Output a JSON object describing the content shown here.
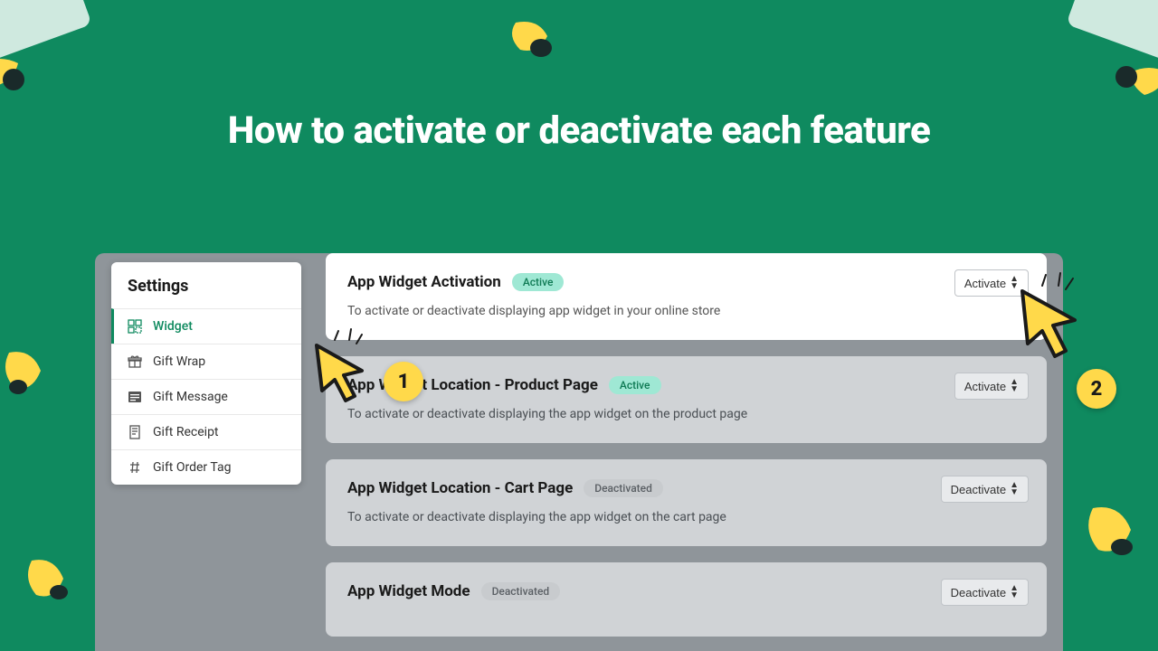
{
  "title": "How to activate or deactivate each feature",
  "sidebar": {
    "heading": "Settings",
    "items": [
      {
        "label": "Widget",
        "icon": "widget"
      },
      {
        "label": "Gift Wrap",
        "icon": "gift"
      },
      {
        "label": "Gift Message",
        "icon": "message"
      },
      {
        "label": "Gift Receipt",
        "icon": "receipt"
      },
      {
        "label": "Gift Order Tag",
        "icon": "hash"
      }
    ]
  },
  "cards": [
    {
      "title": "App Widget Activation",
      "badge": "Active",
      "badge_state": "active",
      "desc": "To activate or deactivate displaying app widget in your online store",
      "button": "Activate"
    },
    {
      "title": "App Widget Location - Product Page",
      "badge": "Active",
      "badge_state": "active",
      "desc": "To activate or deactivate displaying the app widget on the product page",
      "button": "Activate"
    },
    {
      "title": "App Widget Location - Cart Page",
      "badge": "Deactivated",
      "badge_state": "inactive",
      "desc": "To activate or deactivate displaying the app widget on the cart page",
      "button": "Deactivate"
    },
    {
      "title": "App Widget Mode",
      "badge": "Deactivated",
      "badge_state": "inactive",
      "desc": "",
      "button": "Deactivate"
    }
  ],
  "steps": {
    "one": "1",
    "two": "2"
  }
}
